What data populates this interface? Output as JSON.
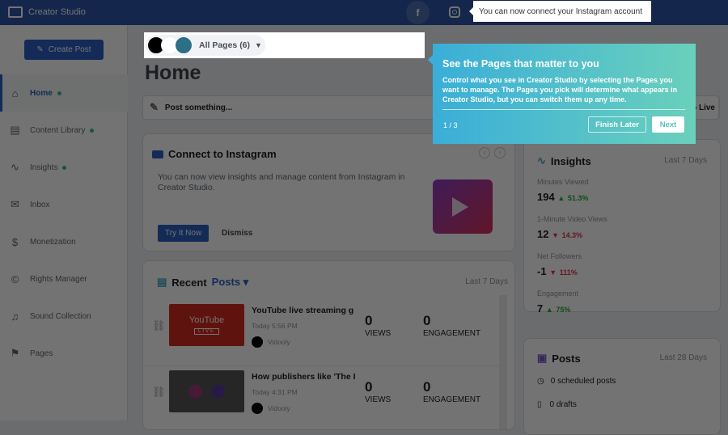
{
  "header": {
    "app_title": "Creator Studio",
    "facebook_icon": "facebook-icon",
    "instagram_icon": "instagram-icon"
  },
  "instagram_tooltip": "You can now connect your Instagram account",
  "sidebar": {
    "create_post": "Create Post",
    "items": [
      {
        "label": "Home",
        "icon": "⌂",
        "dot": true
      },
      {
        "label": "Content Library",
        "icon": "▤",
        "dot": true
      },
      {
        "label": "Insights",
        "icon": "∿",
        "dot": true
      },
      {
        "label": "Inbox",
        "icon": "✉",
        "dot": false
      },
      {
        "label": "Monetization",
        "icon": "$",
        "dot": false
      },
      {
        "label": "Rights Manager",
        "icon": "©",
        "dot": false
      },
      {
        "label": "Sound Collection",
        "icon": "♫",
        "dot": false
      },
      {
        "label": "Pages",
        "icon": "⚑",
        "dot": false
      }
    ]
  },
  "page_selector": {
    "label": "All Pages (6)"
  },
  "page_title": "Home",
  "post_bar": {
    "placeholder": "Post something...",
    "go_live": "Go Live"
  },
  "connect_card": {
    "title": "Connect to Instagram",
    "body": "You can now view insights and manage content from Instagram in Creator Studio.",
    "try_button": "Try It Now",
    "dismiss": "Dismiss"
  },
  "recent": {
    "title": "Recent",
    "filter": "Posts",
    "range": "Last 7 Days",
    "posts": [
      {
        "title": "YouTube live streaming g",
        "time": "Today 5:56 PM",
        "page": "Vidooly",
        "views": "0",
        "views_label": "VIEWS",
        "engagement": "0",
        "engagement_label": "ENGAGEMENT",
        "thumb_text": "YouTube",
        "thumb_badge": "LIVE"
      },
      {
        "title": "How publishers like 'The I",
        "time": "Today 4:31 PM",
        "page": "Vidooly",
        "views": "0",
        "views_label": "VIEWS",
        "engagement": "0",
        "engagement_label": "ENGAGEMENT"
      }
    ]
  },
  "insights": {
    "title": "Insights",
    "range": "Last 7 Days",
    "metrics": [
      {
        "label": "Minutes Viewed",
        "value": "194",
        "change": "51.3%",
        "dir": "up"
      },
      {
        "label": "1-Minute Video Views",
        "value": "12",
        "change": "14.3%",
        "dir": "down"
      },
      {
        "label": "Net Followers",
        "value": "-1",
        "change": "111%",
        "dir": "down"
      },
      {
        "label": "Engagement",
        "value": "7",
        "change": "75%",
        "dir": "up"
      }
    ]
  },
  "posts": {
    "title": "Posts",
    "range": "Last 28 Days",
    "scheduled": "0 scheduled posts",
    "drafts": "0 drafts"
  },
  "tour": {
    "title": "See the Pages that matter to you",
    "body": "Control what you see in Creator Studio by selecting the Pages you want to manage. The Pages you pick will determine what appears in Creator Studio, but you can switch them up any time.",
    "step": "1 / 3",
    "finish_later": "Finish Later",
    "next": "Next"
  },
  "colors": {
    "header": "#2d55a8",
    "accent": "#2d5fc4",
    "up": "#2aa63c",
    "down": "#e0334d"
  }
}
